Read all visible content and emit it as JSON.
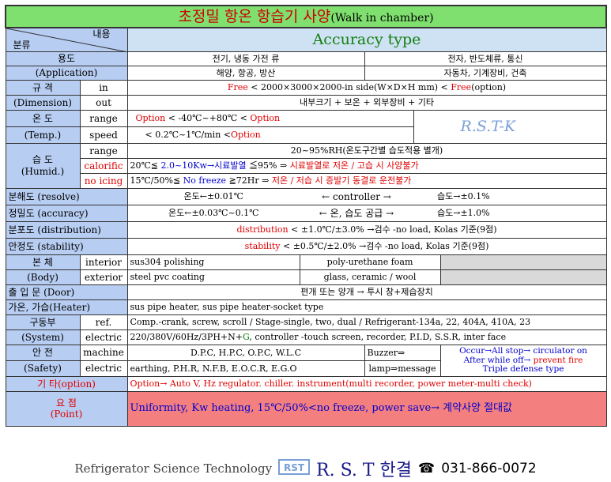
{
  "title": {
    "main": "초정밀 항온 항습기  사양",
    "suffix": "(Walk in chamber)"
  },
  "header": {
    "content_label": "내용",
    "class_label": "분류",
    "type": "Accuracy type"
  },
  "rows": {
    "use": {
      "label": "용도",
      "label_en": "(Application)",
      "a1": "전기, 냉동 가전 류",
      "a2": "전자, 반도체류, 통신",
      "b1": "해양,  항공, 방산",
      "b2": "자동차, 기계장비, 건축"
    },
    "dim": {
      "label": "규 격",
      "label_en": "(Dimension)",
      "in": "in",
      "out": "out",
      "in_red1": "Free",
      "in_text": " < 2000×3000×2000-in side(W×D×H mm) < ",
      "in_red2": "Free",
      "in_tail": "(option)",
      "out_text": "내부크기 + 보온 + 외부장비 + 기타"
    },
    "temp": {
      "label": "온 도",
      "label_en": "(Temp.)",
      "range": "range",
      "speed": "speed",
      "range_red1": "Option",
      "range_text": "  <  -40℃~+80℃   < ",
      "range_red2": "Option",
      "speed_text": "<  0.2℃~1℃/min <",
      "speed_red": "Option",
      "watermark": "R.S.T-K"
    },
    "humid": {
      "label": "습 도",
      "label_en": "(Humid.)",
      "range": "range",
      "calorific": "calorific",
      "noicing": "no icing",
      "range_text": "20~95%RH(온도구간별 습도적용 별개)",
      "cal_a": "20℃≦ ",
      "cal_b": "2.0~10Kw→시료발열",
      "cal_c": " ≦95% ⇒ ",
      "cal_d": "시료발열로 저온 / 고습 시 사양불가",
      "ice_a": "15℃/50%≦ ",
      "ice_b": "No freeze",
      "ice_c": " ≧72Hr  ⇒  ",
      "ice_d": "저온 / 저습 시 증발기 동결로 운전불가"
    },
    "resolve": {
      "label": "분해도 (resolve)",
      "a": "온도←±0.01℃",
      "b": "←    controller    →",
      "c": "습도→±0.1%"
    },
    "accuracy": {
      "label": "정밀도 (accuracy)",
      "a": "온도←±0.03℃~0.1℃",
      "b": "← 온, 습도 공급   →",
      "c": "습도→±1.0%"
    },
    "distribution": {
      "label": "분포도 (distribution)",
      "red": "distribution",
      "text": " < ±1.0℃/±3.0% →검수 -no load, Kolas 기준(9점)"
    },
    "stability": {
      "label": "안정도 (stability)",
      "red": "stability",
      "text": " < ±0.5℃/±2.0% →검수 -no load, Kolas 기준(9점)"
    },
    "body": {
      "label": "본 체",
      "label_en": "(Body)",
      "interior": "interior",
      "exterior": "exterior",
      "int_a": "sus304 polishing",
      "int_b": "poly-urethane foam",
      "ext_a": "steel pvc coating",
      "ext_b": "glass, ceramic / wool"
    },
    "door": {
      "label": "출 입 문    (Door)",
      "text": "편개 또는 양개 → 투시 창+제습장치"
    },
    "heater": {
      "label": "가온, 가습(Heater)",
      "text": "sus pipe heater,  sus pipe heater-socket type"
    },
    "system": {
      "label": "구동부",
      "label_en": "(System)",
      "ref": "ref.",
      "electric": "electric",
      "ref_text": "Comp.-crank, screw, scroll / Stage-single, two, dual / Refrigerant-134a, 22, 404A, 410A, 23",
      "elec_a": "220/380V/60Hz/3PH+N+",
      "elec_g": "G",
      "elec_b": ", controller -touch screen, recorder, P.I.D, S.S.R, inter face"
    },
    "safety": {
      "label": "안 전",
      "label_en": "(Safety)",
      "machine": "machine",
      "electric": "electric",
      "mach_text": "D.P.C,  H.P.C,  O.P.C,  W.L.C",
      "elec_text": "earthing,  P.H.R,  N.F.B,  E.O.C.R,   E.G.O",
      "buzzer": "Buzzer⇒",
      "lamp": "lamp⇒message",
      "occur": "Occur→All stop→ circulator on",
      "after_a": "After while off→ ",
      "after_red": "prevent fire",
      "triple": "Triple defense type"
    },
    "etc": {
      "label": "기 타(option)",
      "text": "Option→ Auto V, Hz regulator. chiller.  instrument(multi recorder, power meter-multi check)"
    },
    "point": {
      "label": "요 점",
      "label_en": "(Point)",
      "text": "Uniformity, Kw  heating,  15℃/50%<no freeze,  power save→ 계약사양 절대값"
    }
  },
  "footer": {
    "company_en": "Refrigerator Science Technology",
    "company": "R. S. T 한결",
    "phone_icon": "☎",
    "phone": "031-866-0072"
  },
  "colors": {
    "title_bg": "#7fe06f",
    "category_bg": "#b7cdf2",
    "point_bg": "#f47f7f",
    "accent_red": "#e00000",
    "accent_blue": "#0000cc"
  }
}
